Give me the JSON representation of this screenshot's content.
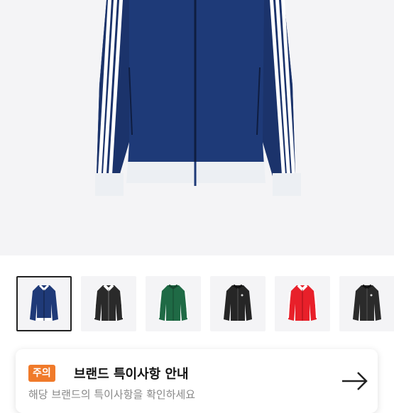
{
  "product": {
    "main_image": "navy-track-jacket-photo",
    "thumbnails": [
      {
        "name": "navy-jacket",
        "body": "#1f3a78",
        "accent": "#ffffff",
        "selected": true
      },
      {
        "name": "black-white-jacket",
        "body": "#2a2a2a",
        "accent": "#ffffff",
        "selected": false
      },
      {
        "name": "green-jacket",
        "body": "#1f6a45",
        "accent": "#ffffff",
        "selected": false
      },
      {
        "name": "black-jacket",
        "body": "#262626",
        "accent": "#dddddd",
        "selected": false
      },
      {
        "name": "red-jacket",
        "body": "#e8202a",
        "accent": "#ffffff",
        "selected": false
      },
      {
        "name": "dark-jacket",
        "body": "#2b2b2b",
        "accent": "#dddddd",
        "selected": false
      }
    ]
  },
  "notice": {
    "badge": "주의",
    "title": "브랜드 특이사항 안내",
    "subtitle": "해당 브랜드의 특이사항을 확인하세요",
    "arrow_icon": "arrow-right-icon"
  },
  "colors": {
    "badge_bg": "#f07a2a",
    "hero_bg": "#f4f4f6"
  }
}
